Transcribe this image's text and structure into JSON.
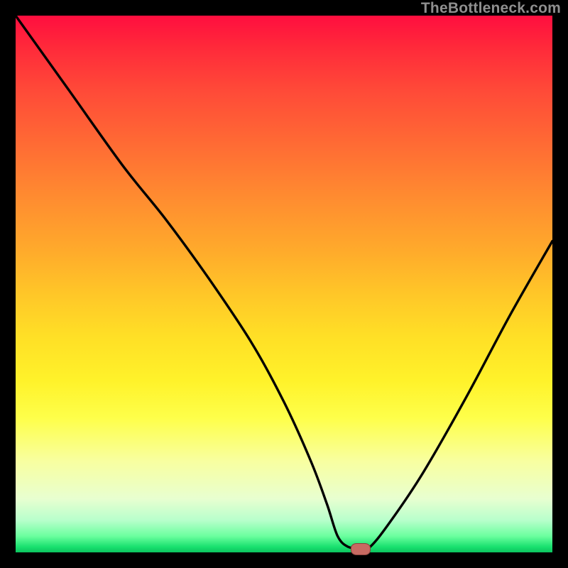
{
  "watermark": "TheBottleneck.com",
  "marker": {
    "cx_frac": 0.642,
    "cy_frac": 0.994
  },
  "chart_data": {
    "type": "line",
    "title": "",
    "xlabel": "",
    "ylabel": "",
    "xlim": [
      0,
      100
    ],
    "ylim": [
      0,
      100
    ],
    "grid": false,
    "legend": false,
    "background": "red-yellow-green vertical gradient (red=top=100, green=bottom=0)",
    "series": [
      {
        "name": "bottleneck-curve",
        "x": [
          0,
          10,
          20,
          28,
          36,
          44,
          50,
          55,
          58,
          60,
          62,
          64,
          66,
          70,
          76,
          84,
          92,
          100
        ],
        "values": [
          100,
          86,
          72,
          62,
          51,
          39,
          28,
          17,
          9,
          3,
          1,
          1,
          1,
          6,
          15,
          29,
          44,
          58
        ]
      }
    ],
    "annotations": [
      {
        "type": "marker",
        "x": 64.2,
        "y": 0.6,
        "label": "optimal-point",
        "color": "#c86a62"
      }
    ]
  }
}
